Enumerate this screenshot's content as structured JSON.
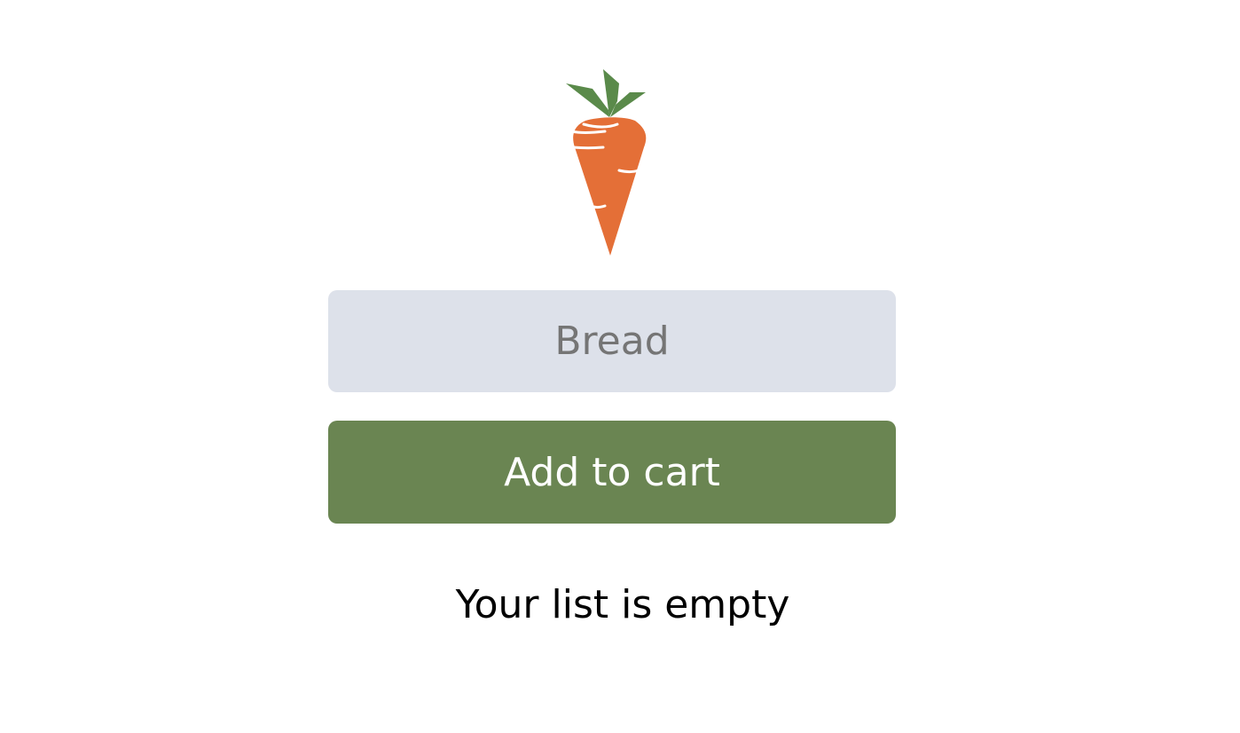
{
  "logo": {
    "icon": "carrot-icon",
    "carrot_color": "#e46f37",
    "leaf_color": "#5a8a4a"
  },
  "form": {
    "input_placeholder": "Bread",
    "input_value": "",
    "add_button_label": "Add to cart"
  },
  "list": {
    "empty_message": "Your list is empty"
  },
  "colors": {
    "input_background": "#dde1ea",
    "button_background": "#6a8552",
    "button_text": "#ffffff"
  }
}
